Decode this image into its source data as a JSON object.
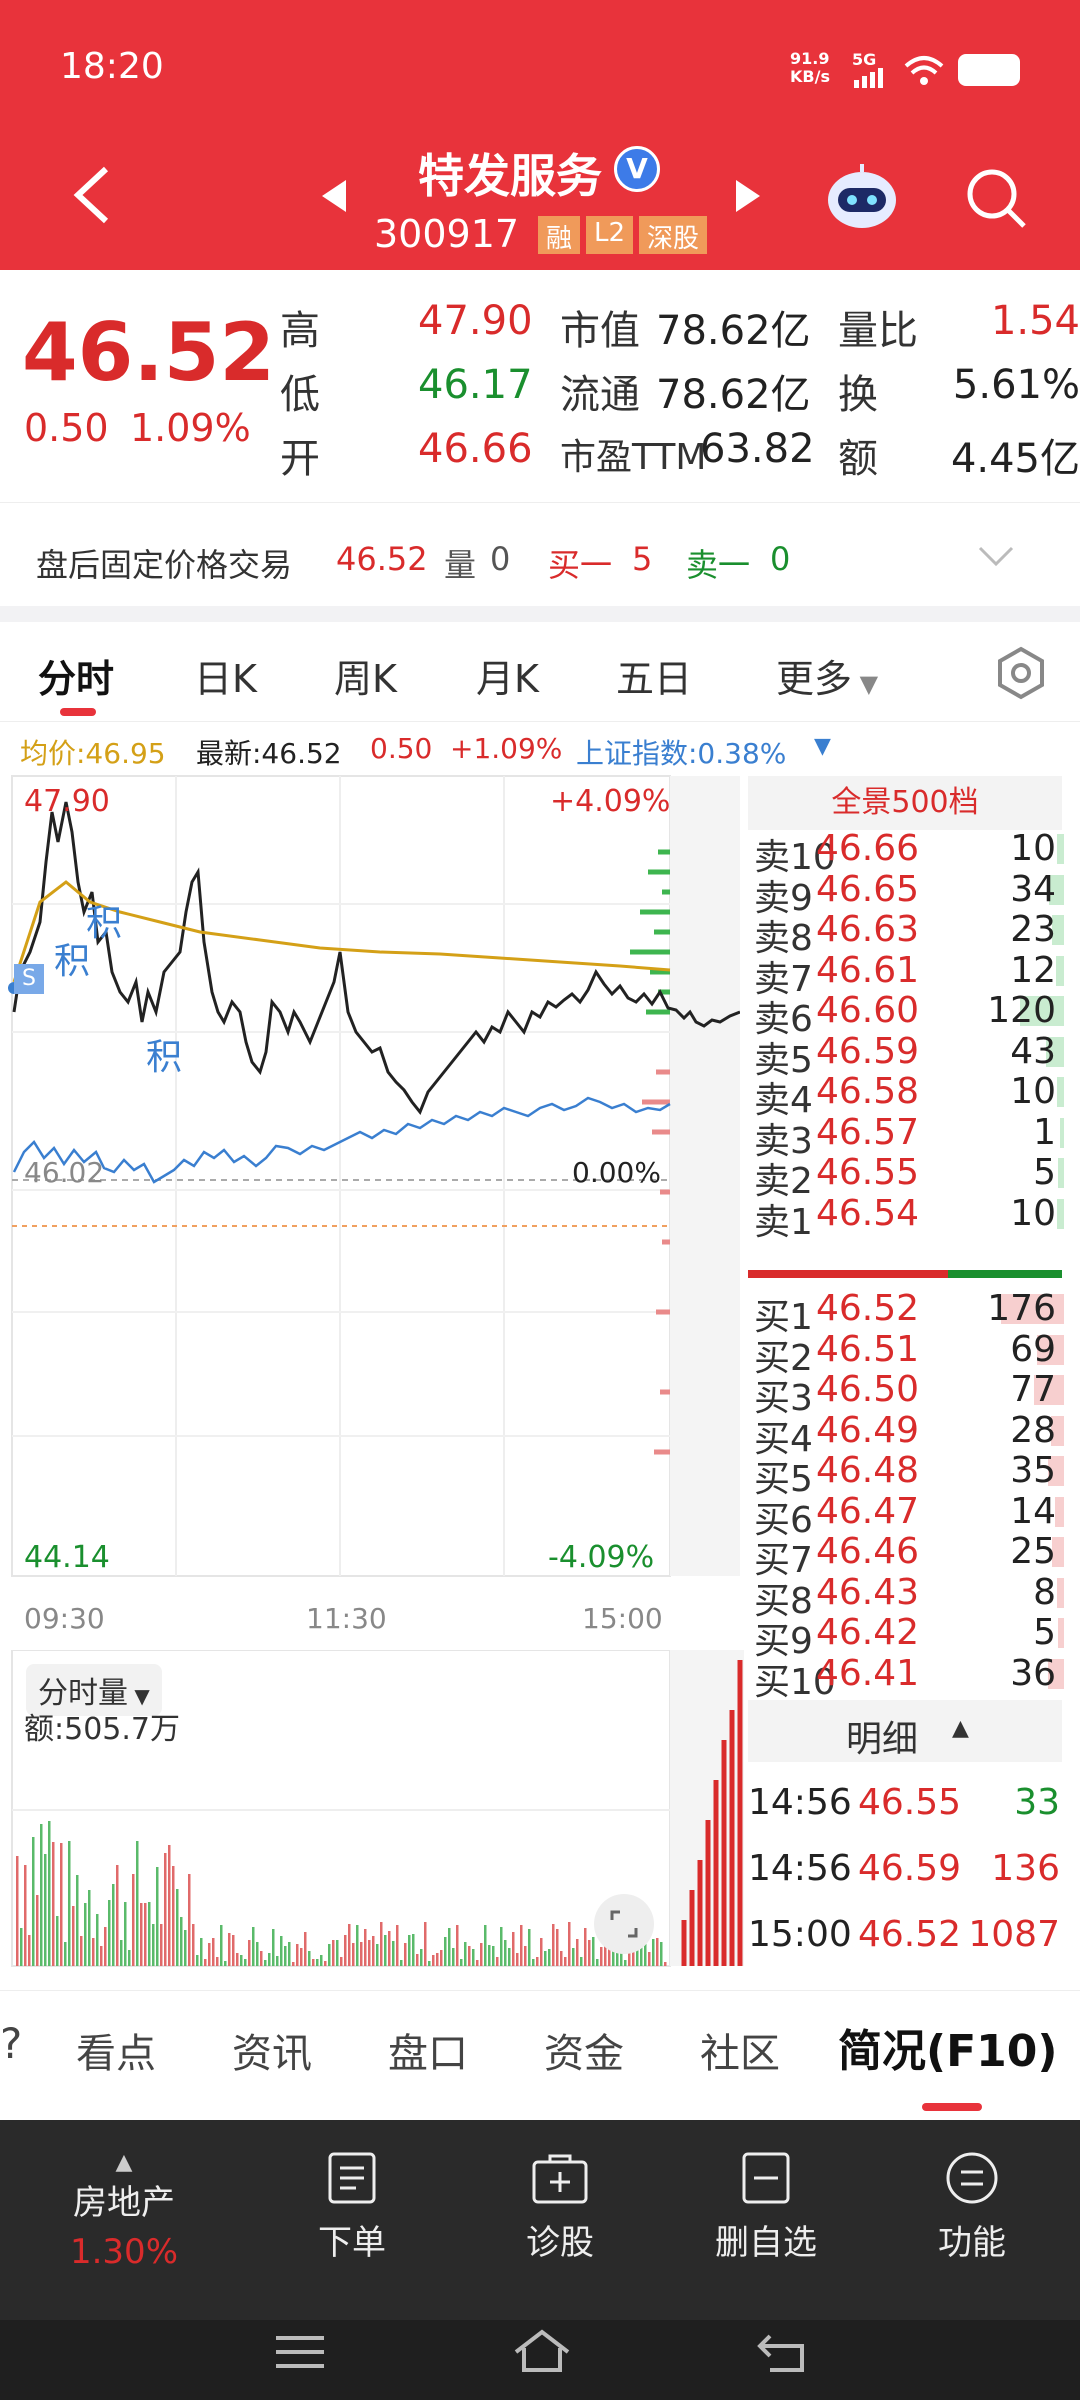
{
  "status": {
    "time": "18:20",
    "net_speed": "91.9",
    "net_unit": "KB/s",
    "signal": "5G"
  },
  "header": {
    "name": "特发服务",
    "code": "300917",
    "badges": [
      "融",
      "L2",
      "深股"
    ]
  },
  "price": {
    "last": "46.52",
    "change": "0.50",
    "pct": "1.09%"
  },
  "stats": {
    "high_label": "高",
    "high": "47.90",
    "low_label": "低",
    "low": "46.17",
    "open_label": "开",
    "open": "46.66",
    "mcap_label": "市值",
    "mcap": "78.62亿",
    "float_label": "流通",
    "float": "78.62亿",
    "pe_label": "市盈TTM",
    "pe": "63.82",
    "vr_label": "量比",
    "vr": "1.54",
    "turn_label": "换",
    "turn": "5.61%",
    "amt_label": "额",
    "amt": "4.45亿"
  },
  "after_hours": {
    "label": "盘后固定价格交易",
    "price": "46.52",
    "vol_label": "量",
    "vol": "0",
    "buy_label": "买一",
    "buy": "5",
    "sell_label": "卖一",
    "sell": "0"
  },
  "chart_tabs": [
    "分时",
    "日K",
    "周K",
    "月K",
    "五日",
    "更多"
  ],
  "legend": {
    "avg": "均价:46.95",
    "latest_label": "最新:46.52",
    "chg": "0.50",
    "pct": "+1.09%",
    "index": "上证指数:0.38%"
  },
  "chart": {
    "top_price": "47.90",
    "top_pct": "+4.09%",
    "mid_price": "46.02",
    "mid_pct": "0.00%",
    "bot_price": "44.14",
    "bot_pct": "-4.09%",
    "t_start": "09:30",
    "t_mid": "11:30",
    "t_end": "15:00",
    "marks": [
      "S",
      "积",
      "积",
      "积"
    ]
  },
  "volume": {
    "title": "分时量",
    "amount": "额:505.7万"
  },
  "book": {
    "title": "全景500档",
    "asks": [
      {
        "label": "卖10",
        "price": "46.66",
        "vol": "10"
      },
      {
        "label": "卖9",
        "price": "46.65",
        "vol": "34"
      },
      {
        "label": "卖8",
        "price": "46.63",
        "vol": "23"
      },
      {
        "label": "卖7",
        "price": "46.61",
        "vol": "12"
      },
      {
        "label": "卖6",
        "price": "46.60",
        "vol": "120"
      },
      {
        "label": "卖5",
        "price": "46.59",
        "vol": "43"
      },
      {
        "label": "卖4",
        "price": "46.58",
        "vol": "10"
      },
      {
        "label": "卖3",
        "price": "46.57",
        "vol": "1"
      },
      {
        "label": "卖2",
        "price": "46.55",
        "vol": "5"
      },
      {
        "label": "卖1",
        "price": "46.54",
        "vol": "10"
      }
    ],
    "bids": [
      {
        "label": "买1",
        "price": "46.52",
        "vol": "176"
      },
      {
        "label": "买2",
        "price": "46.51",
        "vol": "69"
      },
      {
        "label": "买3",
        "price": "46.50",
        "vol": "77"
      },
      {
        "label": "买4",
        "price": "46.49",
        "vol": "28"
      },
      {
        "label": "买5",
        "price": "46.48",
        "vol": "35"
      },
      {
        "label": "买6",
        "price": "46.47",
        "vol": "14"
      },
      {
        "label": "买7",
        "price": "46.46",
        "vol": "25"
      },
      {
        "label": "买8",
        "price": "46.43",
        "vol": "8"
      },
      {
        "label": "买9",
        "price": "46.42",
        "vol": "5"
      },
      {
        "label": "买10",
        "price": "46.41",
        "vol": "36"
      }
    ]
  },
  "detail": {
    "title": "明细",
    "rows": [
      {
        "time": "14:56",
        "price": "46.55",
        "vol": "33",
        "dir": "buy"
      },
      {
        "time": "14:56",
        "price": "46.59",
        "vol": "136",
        "dir": "sell"
      },
      {
        "time": "15:00",
        "price": "46.52",
        "vol": "1087",
        "dir": "sell"
      }
    ]
  },
  "bottom_tabs": [
    "看点",
    "资讯",
    "盘口",
    "资金",
    "社区",
    "简况(F10)"
  ],
  "nav": {
    "sector": "房地产",
    "sector_pct": "1.30%",
    "order": "下单",
    "diagnose": "诊股",
    "remove": "删自选",
    "func": "功能"
  },
  "colors": {
    "header": "#e8333b",
    "up": "#d92b2b",
    "down": "#1a8f2e",
    "avg": "#d4a017",
    "index": "#3a7fd0"
  }
}
